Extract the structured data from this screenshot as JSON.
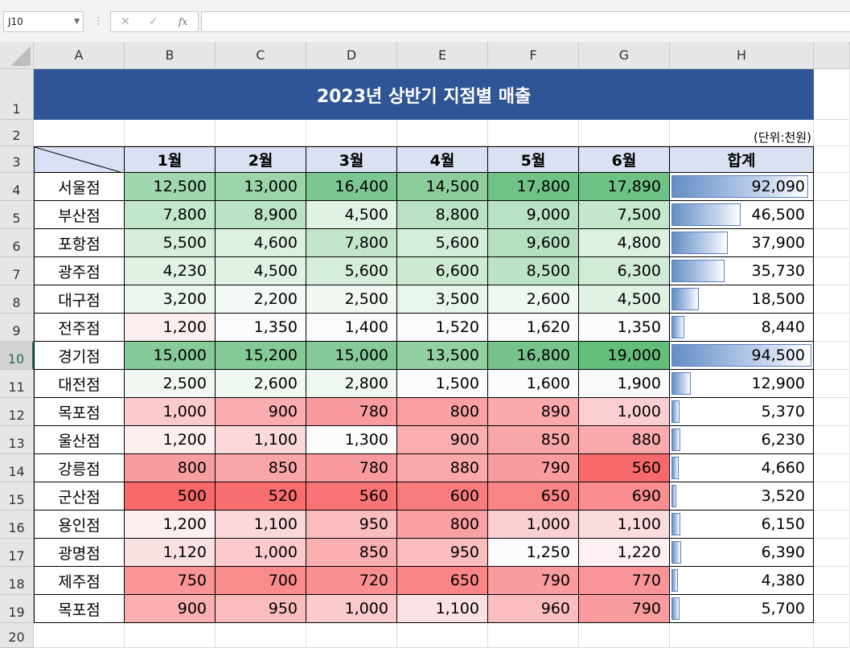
{
  "formula_bar": {
    "name_box": "J10",
    "dots": "⋮",
    "cancel_glyph": "✕",
    "enter_glyph": "✓",
    "fx_glyph": "fx"
  },
  "columns": [
    "A",
    "B",
    "C",
    "D",
    "E",
    "F",
    "G",
    "H"
  ],
  "row_numbers": [
    "1",
    "2",
    "3",
    "4",
    "5",
    "6",
    "7",
    "8",
    "9",
    "10",
    "11",
    "12",
    "13",
    "14",
    "15",
    "16",
    "17",
    "18",
    "19",
    "20"
  ],
  "selected_row": "10",
  "sheet": {
    "title": "2023년 상반기 지점별 매출",
    "unit_label": "(단위:천원)",
    "month_headers": [
      "1월",
      "2월",
      "3월",
      "4월",
      "5월",
      "6월"
    ],
    "total_header": "합계",
    "bar_max": 94500,
    "colors": {
      "title_bg": "#2f5597",
      "header_bg": "#d9e1f2",
      "scale_green": "#63be7b",
      "scale_red": "#f8696b",
      "bar_blue": "#638ec6"
    },
    "branches": [
      {
        "name": "서울점",
        "values": [
          "12,500",
          "13,000",
          "16,400",
          "14,500",
          "17,800",
          "17,890"
        ],
        "total": "92,090",
        "total_value": 92090,
        "fills": [
          "#a1d7ae",
          "#9ad4a8",
          "#7cc791",
          "#8dcd9c",
          "#70c287",
          "#6fc286"
        ]
      },
      {
        "name": "부산점",
        "values": [
          "7,800",
          "8,900",
          "4,500",
          "8,800",
          "9,000",
          "7,500"
        ],
        "total": "46,500",
        "total_value": 46500,
        "fills": [
          "#c2e6ca",
          "#bbe2c4",
          "#e0f2e4",
          "#bbe2c4",
          "#b9e1c3",
          "#c4e7cc"
        ]
      },
      {
        "name": "포항점",
        "values": [
          "5,500",
          "4,600",
          "7,800",
          "5,600",
          "9,600",
          "4,800"
        ],
        "total": "37,900",
        "total_value": 37900,
        "fills": [
          "#d6eedb",
          "#ddf1e1",
          "#c3e6cb",
          "#d5eedb",
          "#b5dfbf",
          "#dcf1e0"
        ]
      },
      {
        "name": "광주점",
        "values": [
          "4,230",
          "4,500",
          "5,600",
          "6,600",
          "8,500",
          "6,300"
        ],
        "total": "35,730",
        "total_value": 35730,
        "fills": [
          "#e1f2e5",
          "#dff2e3",
          "#d5eedb",
          "#cdeaD3",
          "#bde3c6",
          "#cfebd5"
        ]
      },
      {
        "name": "대구점",
        "values": [
          "3,200",
          "2,200",
          "2,500",
          "3,500",
          "2,600",
          "4,500"
        ],
        "total": "18,500",
        "total_value": 18500,
        "fills": [
          "#ebf6ed",
          "#f3f9f4",
          "#f1f8f2",
          "#e8f5eb",
          "#f0f8f2",
          "#dff2e3"
        ]
      },
      {
        "name": "전주점",
        "values": [
          "1,200",
          "1,350",
          "1,400",
          "1,520",
          "1,620",
          "1,350"
        ],
        "total": "8,440",
        "total_value": 8440,
        "fills": [
          "#fdeef0",
          "#fcfcff",
          "#fcfcff",
          "#fcfcff",
          "#fcfcff",
          "#fcfcff"
        ]
      },
      {
        "name": "경기점",
        "values": [
          "15,000",
          "15,200",
          "15,000",
          "13,500",
          "16,800",
          "19,000"
        ],
        "total": "94,500",
        "total_value": 94500,
        "fills": [
          "#85ca98",
          "#84ca97",
          "#85ca98",
          "#93d0a1",
          "#76c48b",
          "#63be7b"
        ]
      },
      {
        "name": "대전점",
        "values": [
          "2,500",
          "2,600",
          "2,800",
          "1,500",
          "1,600",
          "1,900"
        ],
        "total": "12,900",
        "total_value": 12900,
        "fills": [
          "#f1f8f2",
          "#f0f8f2",
          "#eef7f0",
          "#fcfcff",
          "#fcfcff",
          "#f8fbf9"
        ]
      },
      {
        "name": "목포점",
        "values": [
          "1,000",
          "900",
          "780",
          "800",
          "890",
          "1,000"
        ],
        "total": "5,370",
        "total_value": 5370,
        "fills": [
          "#fbcaCc",
          "#faadb0",
          "#f99b9e",
          "#f9a0a2",
          "#faaaac",
          "#fbcfd1"
        ]
      },
      {
        "name": "울산점",
        "values": [
          "1,200",
          "1,100",
          "1,300",
          "900",
          "850",
          "880"
        ],
        "total": "6,230",
        "total_value": 6230,
        "fills": [
          "#fdeef0",
          "#fbd8da",
          "#fcfcff",
          "#faaeb0",
          "#f9a6a8",
          "#faaaac"
        ]
      },
      {
        "name": "강릉점",
        "values": [
          "800",
          "850",
          "780",
          "880",
          "790",
          "560"
        ],
        "total": "4,660",
        "total_value": 4660,
        "fills": [
          "#f99ea0",
          "#f9a6a8",
          "#f99b9e",
          "#faa8aa",
          "#f99c9f",
          "#f8696b"
        ]
      },
      {
        "name": "군산점",
        "values": [
          "500",
          "520",
          "560",
          "600",
          "650",
          "690"
        ],
        "total": "3,520",
        "total_value": 3520,
        "fills": [
          "#f8696b",
          "#f86d6f",
          "#f87476",
          "#f87c7e",
          "#f98587",
          "#f98d8f"
        ]
      },
      {
        "name": "용인점",
        "values": [
          "1,200",
          "1,100",
          "950",
          "800",
          "1,000",
          "1,100"
        ],
        "total": "6,150",
        "total_value": 6150,
        "fills": [
          "#fdeef0",
          "#fbd8da",
          "#fbbcbe",
          "#f9a0a2",
          "#fbd0d2",
          "#fbdcde"
        ]
      },
      {
        "name": "광명점",
        "values": [
          "1,120",
          "1,000",
          "850",
          "950",
          "1,250",
          "1,220"
        ],
        "total": "6,390",
        "total_value": 6390,
        "fills": [
          "#fbe0e2",
          "#fbcacc",
          "#faafb1",
          "#fbbcbe",
          "#fcfcff",
          "#fdf0f2"
        ]
      },
      {
        "name": "제주점",
        "values": [
          "750",
          "700",
          "720",
          "650",
          "790",
          "770"
        ],
        "total": "4,380",
        "total_value": 4380,
        "fills": [
          "#f99497",
          "#f98b8d",
          "#f98f91",
          "#f98587",
          "#f99c9f",
          "#f99598"
        ]
      },
      {
        "name": "목포점",
        "values": [
          "900",
          "950",
          "1,000",
          "1,100",
          "960",
          "790"
        ],
        "total": "5,700",
        "total_value": 5700,
        "fills": [
          "#faafb1",
          "#fbbcbe",
          "#fbcacc",
          "#fbe1e3",
          "#fbbec0",
          "#f99c9f"
        ]
      }
    ]
  }
}
